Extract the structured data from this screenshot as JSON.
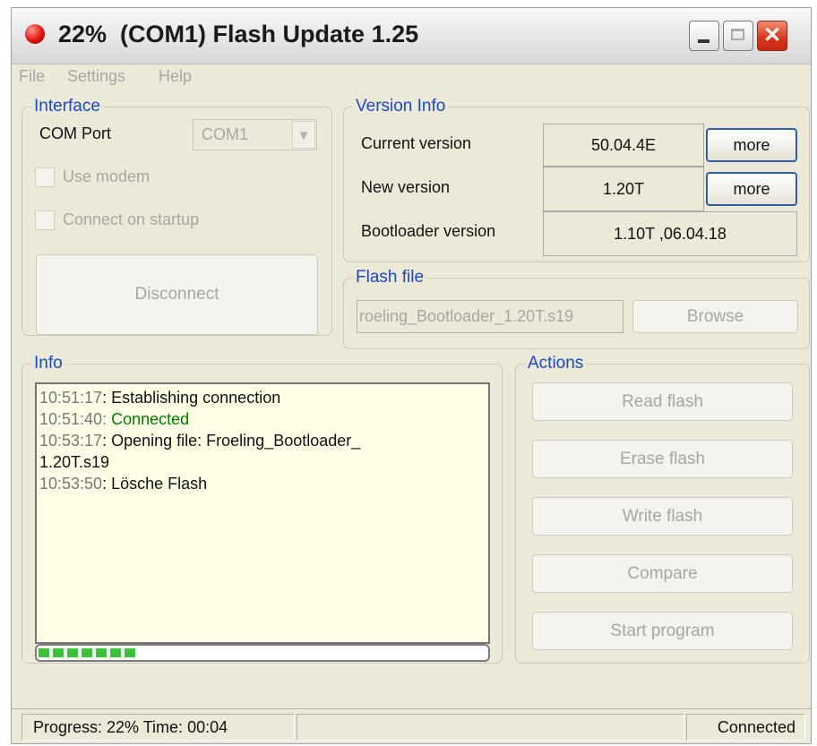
{
  "window": {
    "title": "22%  (COM1) Flash Update 1.25",
    "status_icon": "red-circle",
    "controls": {
      "minimize": "minimize",
      "maximize": "maximize",
      "close": "✕"
    }
  },
  "menu": {
    "items": [
      "File",
      "Settings",
      "Help"
    ]
  },
  "interface": {
    "legend": "Interface",
    "com_port_label": "COM Port",
    "com_port_value": "COM1",
    "use_modem_label": "Use modem",
    "connect_on_startup_label": "Connect on startup",
    "disconnect_label": "Disconnect"
  },
  "version_info": {
    "legend": "Version Info",
    "current_label": "Current version",
    "current_value": "50.04.4E",
    "new_label": "New version",
    "new_value": "1.20T",
    "bootloader_label": "Bootloader version",
    "bootloader_value": "1.10T  ,06.04.18",
    "more_label": "more"
  },
  "flash_file": {
    "legend": "Flash file",
    "path": "roeling_Bootloader_1.20T.s19",
    "browse_label": "Browse"
  },
  "info": {
    "legend": "Info",
    "log": [
      {
        "time": "10:51:17",
        "message": "Establishing connection",
        "status": "normal"
      },
      {
        "time": "10:51:40",
        "message": "Connected",
        "status": "success"
      },
      {
        "time": "10:53:17",
        "message": "Opening file: Froeling_Bootloader_",
        "status": "normal"
      },
      {
        "time": "",
        "message": "1.20T.s19",
        "status": "continuation"
      },
      {
        "time": "10:53:50",
        "message": "Lösche Flash",
        "status": "normal"
      }
    ],
    "progress_fraction": 0.22
  },
  "actions": {
    "legend": "Actions",
    "buttons": [
      "Read flash",
      "Erase flash",
      "Write flash",
      "Compare",
      "Start program"
    ]
  },
  "status_bar": {
    "progress_text": "Progress: 22%  Time: 00:04",
    "connection": "Connected"
  },
  "colors": {
    "accent": "#1a49c6",
    "log_background": "#ffffe7",
    "success": "#007a00",
    "progress": "#38c238",
    "disabled_text": "#a7a6a0"
  }
}
